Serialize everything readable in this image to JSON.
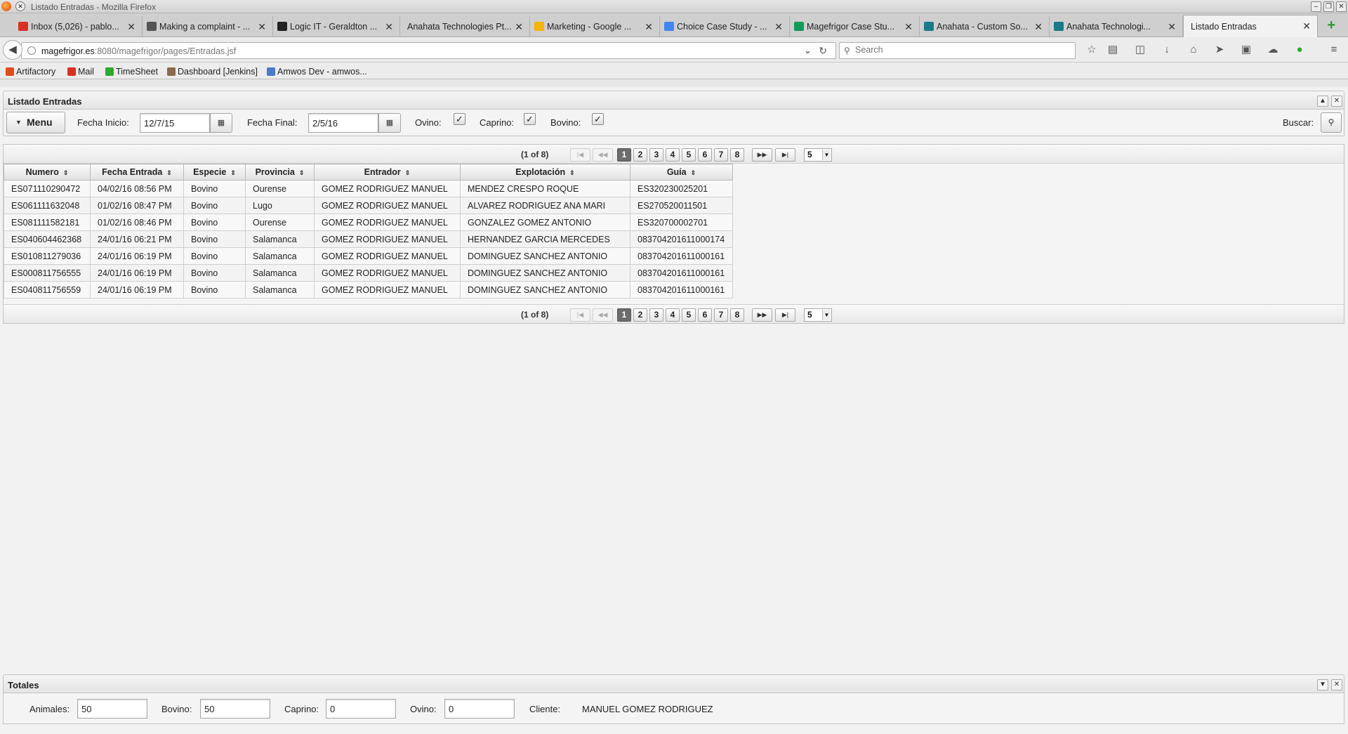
{
  "window": {
    "title": "Listado Entradas - Mozilla Firefox"
  },
  "tabs": [
    {
      "label": "Inbox (5,026) - pablo...",
      "fav": "#d93025"
    },
    {
      "label": "Making a complaint - ...",
      "fav": "#555"
    },
    {
      "label": "Logic IT - Geraldton ...",
      "fav": "#222"
    },
    {
      "label": "Anahata Technologies Pt...",
      "fav": "none"
    },
    {
      "label": "Marketing - Google ...",
      "fav": "#f4b400"
    },
    {
      "label": "Choice Case Study - ...",
      "fav": "#4285f4"
    },
    {
      "label": "Magefrigor Case Stu...",
      "fav": "#0f9d58"
    },
    {
      "label": "Anahata - Custom So...",
      "fav": "#1a7a8a"
    },
    {
      "label": "Anahata Technologi...",
      "fav": "#1a7a8a"
    },
    {
      "label": "Listado Entradas",
      "fav": "none"
    }
  ],
  "nav": {
    "url_host": "magefrigor.es",
    "url_path": ":8080/magefrigor/pages/Entradas.jsf",
    "search_placeholder": "Search"
  },
  "bookmarks": [
    {
      "label": "Artifactory",
      "color": "#e24c1c"
    },
    {
      "label": "Mail",
      "color": "#d93025"
    },
    {
      "label": "TimeSheet",
      "color": "#2ea82e"
    },
    {
      "label": "Dashboard [Jenkins]",
      "color": "#8a6a4a"
    },
    {
      "label": "Amwos Dev - amwos...",
      "color": "#4a7ac8"
    }
  ],
  "filter_panel": {
    "title": "Listado Entradas",
    "menu_label": "Menu",
    "fecha_inicio_label": "Fecha Inicio:",
    "fecha_inicio_value": "12/7/15",
    "fecha_final_label": "Fecha Final:",
    "fecha_final_value": "2/5/16",
    "ovino_label": "Ovino:",
    "caprino_label": "Caprino:",
    "bovino_label": "Bovino:",
    "ovino_checked": true,
    "caprino_checked": true,
    "bovino_checked": true,
    "buscar_label": "Buscar:"
  },
  "paginator": {
    "current": "(1 of 8)",
    "pages": [
      "1",
      "2",
      "3",
      "4",
      "5",
      "6",
      "7",
      "8"
    ],
    "active_page": "1",
    "rows_per_page": "5"
  },
  "table": {
    "columns": [
      "Numero",
      "Fecha Entrada",
      "Especie",
      "Provincia",
      "Entrador",
      "Explotación",
      "Guía"
    ],
    "rows": [
      [
        "ES071110290472",
        "04/02/16 08:56 PM",
        "Bovino",
        "Ourense",
        "GOMEZ RODRIGUEZ MANUEL",
        "MENDEZ CRESPO ROQUE",
        "ES320230025201"
      ],
      [
        "ES061111632048",
        "01/02/16 08:47 PM",
        "Bovino",
        "Lugo",
        "GOMEZ RODRIGUEZ MANUEL",
        "ALVAREZ RODRIGUEZ ANA MARI",
        "ES270520011501"
      ],
      [
        "ES081111582181",
        "01/02/16 08:46 PM",
        "Bovino",
        "Ourense",
        "GOMEZ RODRIGUEZ MANUEL",
        "GONZALEZ GOMEZ ANTONIO",
        "ES320700002701"
      ],
      [
        "ES040604462368",
        "24/01/16 06:21 PM",
        "Bovino",
        "Salamanca",
        "GOMEZ RODRIGUEZ MANUEL",
        "HERNANDEZ GARCIA MERCEDES",
        "083704201611000174"
      ],
      [
        "ES010811279036",
        "24/01/16 06:19 PM",
        "Bovino",
        "Salamanca",
        "GOMEZ RODRIGUEZ MANUEL",
        "DOMINGUEZ SANCHEZ ANTONIO",
        "083704201611000161"
      ],
      [
        "ES000811756555",
        "24/01/16 06:19 PM",
        "Bovino",
        "Salamanca",
        "GOMEZ RODRIGUEZ MANUEL",
        "DOMINGUEZ SANCHEZ ANTONIO",
        "083704201611000161"
      ],
      [
        "ES040811756559",
        "24/01/16 06:19 PM",
        "Bovino",
        "Salamanca",
        "GOMEZ RODRIGUEZ MANUEL",
        "DOMINGUEZ SANCHEZ ANTONIO",
        "083704201611000161"
      ]
    ]
  },
  "totales": {
    "title": "Totales",
    "animales_label": "Animales:",
    "animales_value": "50",
    "bovino_label": "Bovino:",
    "bovino_value": "50",
    "caprino_label": "Caprino:",
    "caprino_value": "0",
    "ovino_label": "Ovino:",
    "ovino_value": "0",
    "cliente_label": "Cliente:",
    "cliente_value": "MANUEL GOMEZ RODRIGUEZ"
  }
}
